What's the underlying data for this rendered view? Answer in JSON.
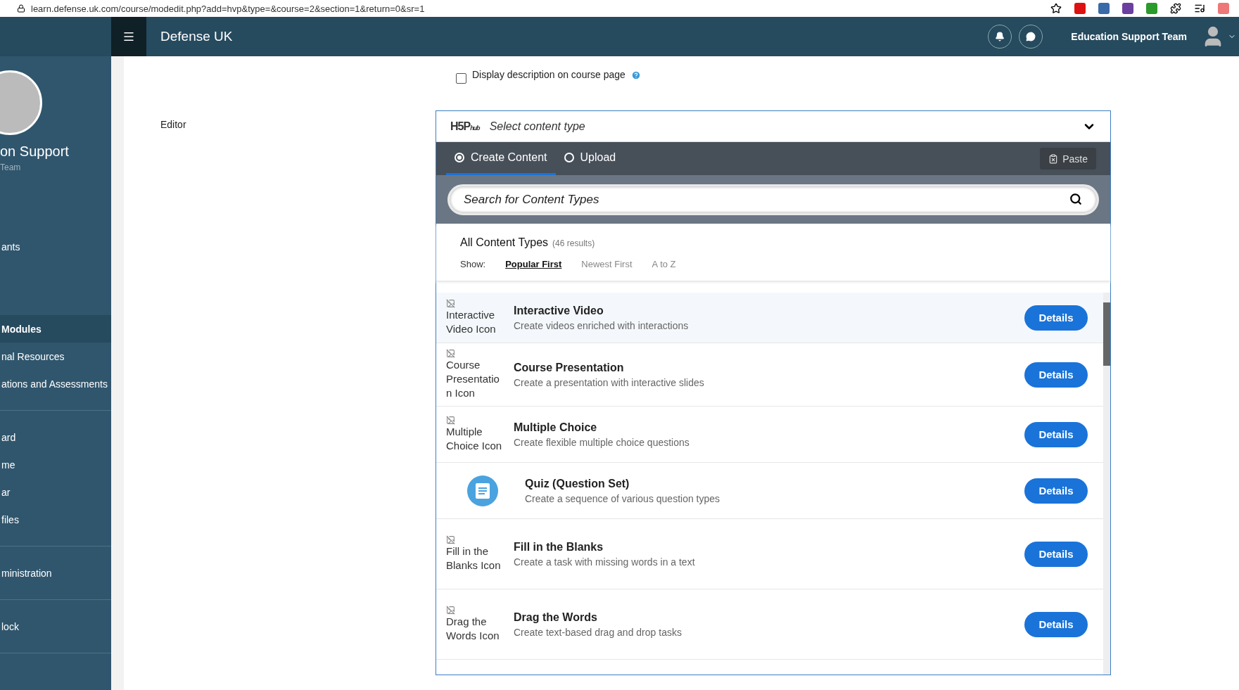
{
  "browser": {
    "url": "learn.defense.uk.com/course/modedit.php?add=hvp&type=&course=2&section=1&return=0&sr=1"
  },
  "navbar": {
    "site_name": "Defense UK",
    "user_name": "Education Support Team"
  },
  "sidebar": {
    "user_name": "on Support",
    "user_role": "Team",
    "groups": [
      [
        {
          "label": "ants",
          "selected": false
        }
      ],
      [
        {
          "label": "Modules",
          "selected": true
        },
        {
          "label": "nal Resources",
          "selected": false
        },
        {
          "label": "ations and Assessments",
          "selected": false
        }
      ],
      [
        {
          "label": "ard",
          "selected": false
        },
        {
          "label": "me",
          "selected": false
        },
        {
          "label": "ar",
          "selected": false
        },
        {
          "label": "files",
          "selected": false
        }
      ],
      [
        {
          "label": "ministration",
          "selected": false
        }
      ],
      [
        {
          "label": "lock",
          "selected": false
        }
      ]
    ]
  },
  "form": {
    "description_checkbox": {
      "label": "Display description on course page",
      "checked": false
    },
    "editor_label": "Editor"
  },
  "h5p": {
    "logo": {
      "main": "H5P",
      "sub": "hub"
    },
    "title": "Select content type",
    "expanded": true,
    "tabs": [
      {
        "label": "Create Content",
        "selected": true
      },
      {
        "label": "Upload",
        "selected": false
      }
    ],
    "paste": "Paste",
    "search": {
      "placeholder": "Search for Content Types"
    },
    "heading": "All Content Types",
    "count": "(46 results)",
    "show_label": "Show:",
    "sort_options": [
      {
        "label": "Popular First",
        "selected": true
      },
      {
        "label": "Newest First",
        "selected": false
      },
      {
        "label": "A to Z",
        "selected": false
      }
    ],
    "items": [
      {
        "kind": "broken",
        "icon_alt": "Interactive Video Icon",
        "title": "Interactive Video",
        "description": "Create videos enriched with interactions",
        "button": "Details",
        "selected": true
      },
      {
        "kind": "broken",
        "icon_alt": "Course Presentation Icon",
        "title": "Course Presentation",
        "description": "Create a presentation with interactive slides",
        "button": "Details",
        "selected": false
      },
      {
        "kind": "broken",
        "icon_alt": "Multiple Choice Icon",
        "title": "Multiple Choice",
        "description": "Create flexible multiple choice questions",
        "button": "Details",
        "selected": false
      },
      {
        "kind": "image",
        "title": "Quiz (Question Set)",
        "description": "Create a sequence of various question types",
        "button": "Details",
        "selected": false
      },
      {
        "kind": "broken",
        "icon_alt": "Fill in the Blanks Icon",
        "title": "Fill in the Blanks",
        "description": "Create a task with missing words in a text",
        "button": "Details",
        "selected": false
      },
      {
        "kind": "broken",
        "icon_alt": "Drag the Words Icon",
        "title": "Drag the Words",
        "description": "Create text-based drag and drop tasks",
        "button": "Details",
        "selected": false
      }
    ]
  }
}
